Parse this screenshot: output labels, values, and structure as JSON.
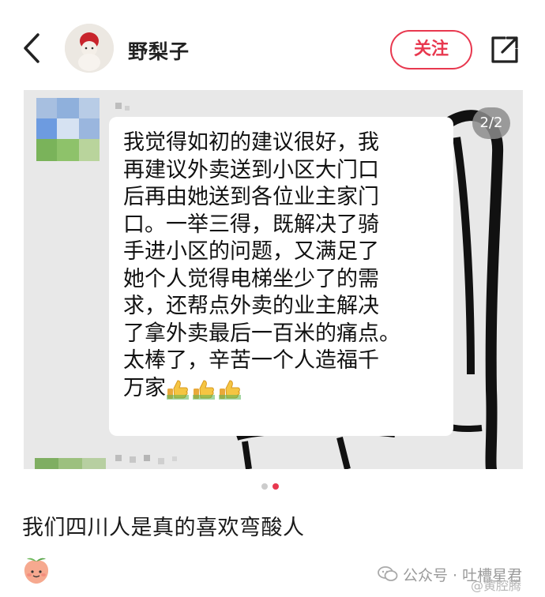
{
  "header": {
    "username": "野梨子",
    "follow_label": "关注"
  },
  "post": {
    "image_counter": "2/2",
    "chat_message": "我觉得如初的建议很好，我\n再建议外卖送到小区大门口\n后再由她送到各位业主家门\n口。一举三得，既解决了骑\n手进小区的问题，又满足了\n她个人觉得电梯坐少了的需\n求，还帮点外卖的业主解决\n了拿外卖最后一百米的痛点。\n太棒了，辛苦一个人造福千\n万家",
    "thumbs_icons": [
      "thumbs-up-emoji",
      "thumbs-up-emoji",
      "thumbs-up-emoji"
    ],
    "page_count": 2,
    "current_page": 2,
    "caption": "我们四川人是真的喜欢弯酸人"
  },
  "footer": {
    "watermark": "公众号 · 吐槽星君",
    "weibo_watermark": "@黄腔腾"
  },
  "colors": {
    "accent": "#e8384f",
    "pager_active": "#e8384f",
    "pager_inactive": "#cccccc"
  },
  "icons": [
    "back-arrow-icon",
    "avatar",
    "share-icon",
    "peach-emoji-icon",
    "wechat-icon"
  ]
}
